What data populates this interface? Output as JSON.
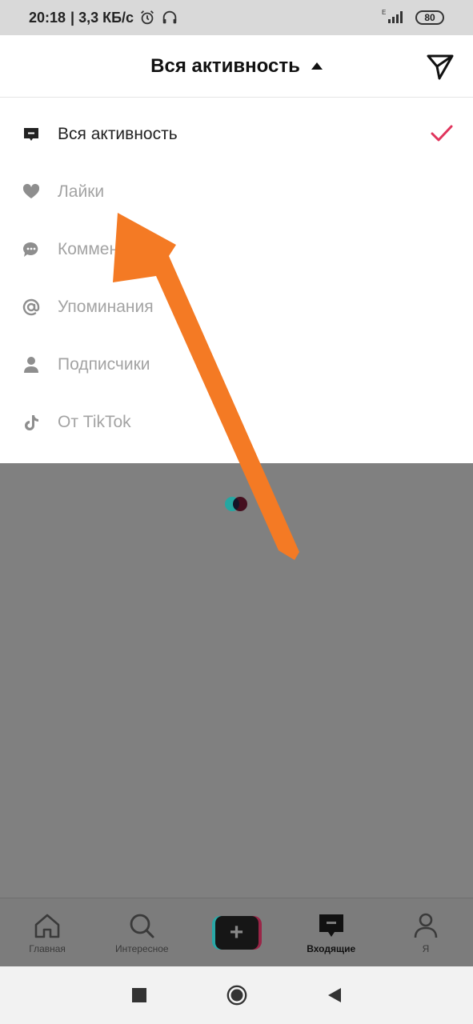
{
  "status_bar": {
    "time": "20:18",
    "network": "| 3,3 КБ/с",
    "signal_label": "E",
    "battery": "80"
  },
  "header": {
    "title": "Вся активность"
  },
  "menu": {
    "items": [
      {
        "label": "Вся активность",
        "icon": "message-square-icon",
        "active": true
      },
      {
        "label": "Лайки",
        "icon": "heart-icon",
        "active": false
      },
      {
        "label": "Комментарии",
        "icon": "comment-icon",
        "active": false
      },
      {
        "label": "Упоминания",
        "icon": "at-icon",
        "active": false
      },
      {
        "label": "Подписчики",
        "icon": "person-icon",
        "active": false
      },
      {
        "label": "От TikTok",
        "icon": "tiktok-icon",
        "active": false
      }
    ]
  },
  "bottom_nav": {
    "items": [
      {
        "label": "Главная",
        "icon": "home-icon"
      },
      {
        "label": "Интересное",
        "icon": "search-icon"
      },
      {
        "label": "",
        "icon": "create-icon"
      },
      {
        "label": "Входящие",
        "icon": "inbox-icon",
        "active": true
      },
      {
        "label": "Я",
        "icon": "profile-icon"
      }
    ]
  },
  "colors": {
    "check": "#e0345c",
    "arrow": "#f47a24",
    "overlay": "#808080",
    "active_text": "#222222",
    "inactive_text": "#a3a3a3"
  }
}
